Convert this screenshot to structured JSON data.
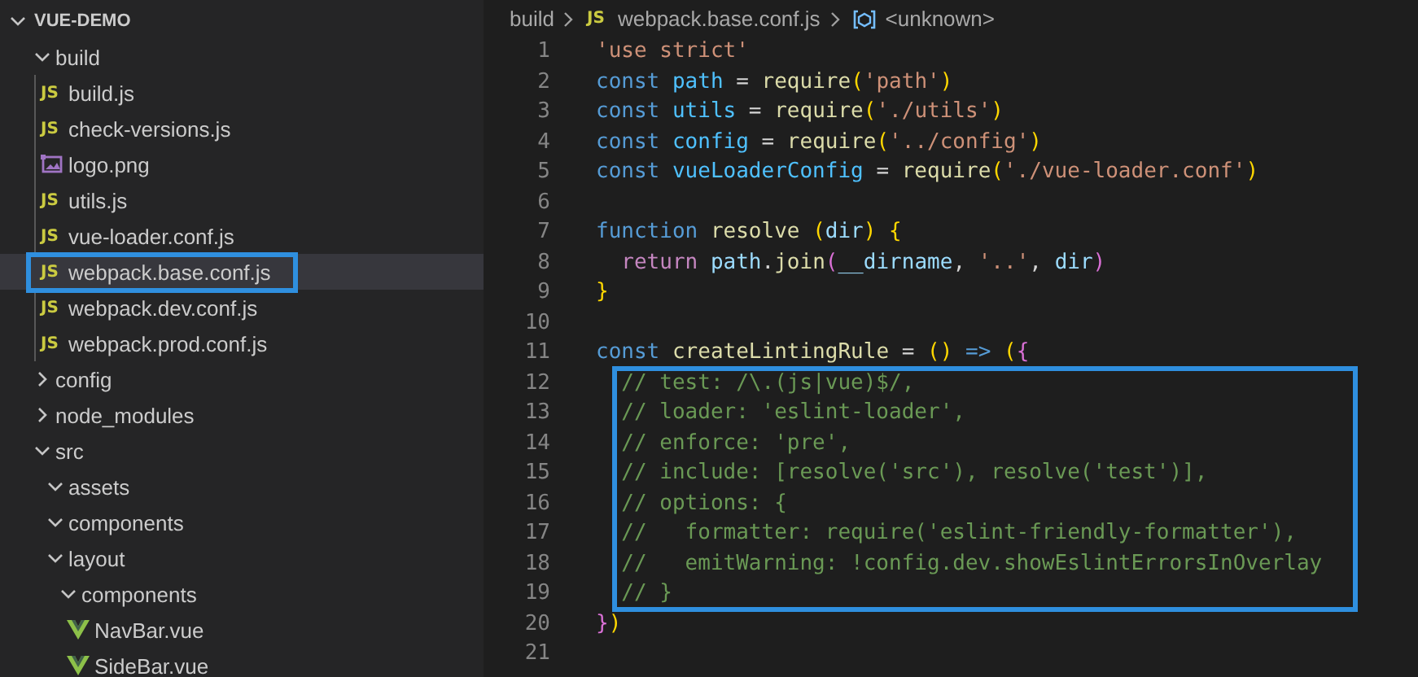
{
  "explorer": {
    "title": "VUE-DEMO",
    "expanded": true,
    "items": [
      {
        "name": "build",
        "kind": "folder",
        "expanded": true,
        "children": [
          {
            "name": "build.js",
            "kind": "js",
            "badge": "JS",
            "selected": false,
            "boxed": false
          },
          {
            "name": "check-versions.js",
            "kind": "js",
            "badge": "JS",
            "selected": false,
            "boxed": false
          },
          {
            "name": "logo.png",
            "kind": "image",
            "selected": false,
            "boxed": false
          },
          {
            "name": "utils.js",
            "kind": "js",
            "badge": "JS",
            "selected": false,
            "boxed": false
          },
          {
            "name": "vue-loader.conf.js",
            "kind": "js",
            "badge": "JS",
            "selected": false,
            "boxed": false
          },
          {
            "name": "webpack.base.conf.js",
            "kind": "js",
            "badge": "JS",
            "selected": true,
            "boxed": true
          },
          {
            "name": "webpack.dev.conf.js",
            "kind": "js",
            "badge": "JS",
            "selected": false,
            "boxed": false
          },
          {
            "name": "webpack.prod.conf.js",
            "kind": "js",
            "badge": "JS",
            "selected": false,
            "boxed": false
          }
        ]
      },
      {
        "name": "config",
        "kind": "folder",
        "expanded": false
      },
      {
        "name": "node_modules",
        "kind": "folder",
        "expanded": false
      },
      {
        "name": "src",
        "kind": "folder",
        "expanded": true,
        "children": [
          {
            "name": "assets",
            "kind": "folder",
            "expanded": true
          },
          {
            "name": "components",
            "kind": "folder",
            "expanded": true
          },
          {
            "name": "layout",
            "kind": "folder",
            "expanded": true,
            "children": [
              {
                "name": "components",
                "kind": "folder",
                "expanded": true,
                "children": [
                  {
                    "name": "NavBar.vue",
                    "kind": "vue",
                    "selected": false,
                    "boxed": false
                  },
                  {
                    "name": "SideBar.vue",
                    "kind": "vue",
                    "selected": false,
                    "boxed": false
                  }
                ]
              }
            ]
          }
        ]
      }
    ]
  },
  "breadcrumb": [
    {
      "text": "build",
      "kind": "folder"
    },
    {
      "text": "webpack.base.conf.js",
      "kind": "js",
      "badge": "JS"
    },
    {
      "text": "<unknown>",
      "kind": "symbol"
    }
  ],
  "editor": {
    "blocks": [
      {
        "kind": "line",
        "number": "1",
        "tokens": [
          {
            "text": "'use strict'",
            "kind": "str"
          }
        ]
      },
      {
        "kind": "line",
        "number": "2",
        "tokens": [
          {
            "text": "const ",
            "kind": "kw"
          },
          {
            "text": "path",
            "kind": "const"
          },
          {
            "text": " = ",
            "kind": "txt"
          },
          {
            "text": "require",
            "kind": "fn"
          },
          {
            "text": "(",
            "kind": "br1"
          },
          {
            "text": "'path'",
            "kind": "str"
          },
          {
            "text": ")",
            "kind": "br1"
          }
        ]
      },
      {
        "kind": "line",
        "number": "3",
        "tokens": [
          {
            "text": "const ",
            "kind": "kw"
          },
          {
            "text": "utils",
            "kind": "const"
          },
          {
            "text": " = ",
            "kind": "txt"
          },
          {
            "text": "require",
            "kind": "fn"
          },
          {
            "text": "(",
            "kind": "br1"
          },
          {
            "text": "'./utils'",
            "kind": "str"
          },
          {
            "text": ")",
            "kind": "br1"
          }
        ]
      },
      {
        "kind": "line",
        "number": "4",
        "tokens": [
          {
            "text": "const ",
            "kind": "kw"
          },
          {
            "text": "config",
            "kind": "const"
          },
          {
            "text": " = ",
            "kind": "txt"
          },
          {
            "text": "require",
            "kind": "fn"
          },
          {
            "text": "(",
            "kind": "br1"
          },
          {
            "text": "'../config'",
            "kind": "str"
          },
          {
            "text": ")",
            "kind": "br1"
          }
        ]
      },
      {
        "kind": "line",
        "number": "5",
        "tokens": [
          {
            "text": "const ",
            "kind": "kw"
          },
          {
            "text": "vueLoaderConfig",
            "kind": "const"
          },
          {
            "text": " = ",
            "kind": "txt"
          },
          {
            "text": "require",
            "kind": "fn"
          },
          {
            "text": "(",
            "kind": "br1"
          },
          {
            "text": "'./vue-loader.conf'",
            "kind": "str"
          },
          {
            "text": ")",
            "kind": "br1"
          }
        ]
      },
      {
        "kind": "line",
        "number": "6"
      },
      {
        "kind": "line",
        "number": "7",
        "tokens": [
          {
            "text": "function ",
            "kind": "kw"
          },
          {
            "text": "resolve ",
            "kind": "fn"
          },
          {
            "text": "(",
            "kind": "br1"
          },
          {
            "text": "dir",
            "kind": "var"
          },
          {
            "text": ") ",
            "kind": "br1"
          },
          {
            "text": "{",
            "kind": "br1"
          }
        ]
      },
      {
        "kind": "line",
        "number": "8",
        "tokens": [
          {
            "text": "  return ",
            "kind": "ctl"
          },
          {
            "text": "path",
            "kind": "var"
          },
          {
            "text": ".",
            "kind": "txt"
          },
          {
            "text": "join",
            "kind": "fn"
          },
          {
            "text": "(",
            "kind": "br2"
          },
          {
            "text": "__dirname",
            "kind": "var"
          },
          {
            "text": ", ",
            "kind": "txt"
          },
          {
            "text": "'..'",
            "kind": "str"
          },
          {
            "text": ", ",
            "kind": "txt"
          },
          {
            "text": "dir",
            "kind": "var"
          },
          {
            "text": ")",
            "kind": "br2"
          }
        ]
      },
      {
        "kind": "line",
        "number": "9",
        "tokens": [
          {
            "text": "}",
            "kind": "br1"
          }
        ]
      },
      {
        "kind": "line",
        "number": "10"
      },
      {
        "kind": "line",
        "number": "11",
        "tokens": [
          {
            "text": "const ",
            "kind": "kw"
          },
          {
            "text": "createLintingRule",
            "kind": "fn"
          },
          {
            "text": " = ",
            "kind": "txt"
          },
          {
            "text": "() ",
            "kind": "br1"
          },
          {
            "text": "=> ",
            "kind": "kw"
          },
          {
            "text": "(",
            "kind": "br1"
          },
          {
            "text": "{",
            "kind": "br2"
          }
        ]
      },
      {
        "kind": "highlight",
        "lines": [
          {
            "number": "12",
            "tokens": [
              {
                "text": "  // test: /\\.(js|vue)$/,",
                "kind": "cmt"
              }
            ]
          },
          {
            "number": "13",
            "tokens": [
              {
                "text": "  // loader: 'eslint-loader',",
                "kind": "cmt"
              }
            ]
          },
          {
            "number": "14",
            "tokens": [
              {
                "text": "  // enforce: 'pre',",
                "kind": "cmt"
              }
            ]
          },
          {
            "number": "15",
            "tokens": [
              {
                "text": "  // include: [resolve('src'), resolve('test')],",
                "kind": "cmt"
              }
            ]
          },
          {
            "number": "16",
            "tokens": [
              {
                "text": "  // options: {",
                "kind": "cmt"
              }
            ]
          },
          {
            "number": "17",
            "tokens": [
              {
                "text": "  //   formatter: require('eslint-friendly-formatter'),",
                "kind": "cmt"
              }
            ]
          },
          {
            "number": "18",
            "tokens": [
              {
                "text": "  //   emitWarning: !config.dev.showEslintErrorsInOverlay",
                "kind": "cmt"
              }
            ]
          },
          {
            "number": "19",
            "tokens": [
              {
                "text": "  // }",
                "kind": "cmt"
              }
            ]
          }
        ]
      },
      {
        "kind": "line",
        "number": "20",
        "tokens": [
          {
            "text": "}",
            "kind": "br2"
          },
          {
            "text": ")",
            "kind": "br1"
          }
        ]
      },
      {
        "kind": "line",
        "number": "21"
      }
    ]
  }
}
